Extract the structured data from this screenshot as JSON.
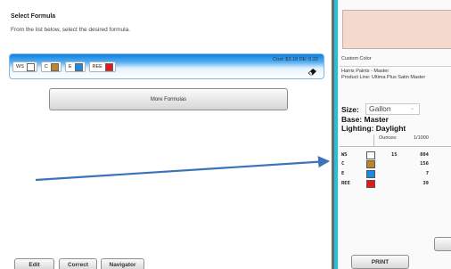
{
  "select_formula": {
    "title": "Select Formula",
    "subtitle": "From the list below, select the desired formula."
  },
  "formula": {
    "cost": "Cost: $3.18 DE: 0.22",
    "chips": [
      {
        "label": "WS",
        "color": "#ffffff"
      },
      {
        "label": "C",
        "color": "#b8862b"
      },
      {
        "label": "E",
        "color": "#1e88e5"
      },
      {
        "label": "REE",
        "color": "#e01919"
      }
    ],
    "eraser_icon": "eraser-icon"
  },
  "more_formulas_label": "More Formulas",
  "annotation": {
    "arrow_color": "#3b73b8"
  },
  "bottom_buttons": {
    "edit": "Edit",
    "correct": "Correct",
    "navigator": "Navigator"
  },
  "right_panel": {
    "preview_color": "#f4d9cd",
    "custom_color_label": "Custom Color",
    "brand": "Harris Paints - Master",
    "product_line": "Product Line:  Ultima Plus Satin Master",
    "size_label": "Size:",
    "size_value": "Gallon",
    "base_label": "Base:",
    "base_value": "Master",
    "lighting_label": "Lighting:",
    "lighting_value": "Daylight",
    "col_ounces": "Ounces:",
    "col_1000": "1/1000",
    "rows": [
      {
        "code": "WS",
        "color": "#ffffff",
        "ounces": "15",
        "k": "804"
      },
      {
        "code": "C",
        "color": "#b8862b",
        "ounces": "",
        "k": "156"
      },
      {
        "code": "E",
        "color": "#1e88e5",
        "ounces": "",
        "k": "7"
      },
      {
        "code": "REE",
        "color": "#e01919",
        "ounces": "",
        "k": "39"
      }
    ],
    "print_label": "PRINT"
  }
}
